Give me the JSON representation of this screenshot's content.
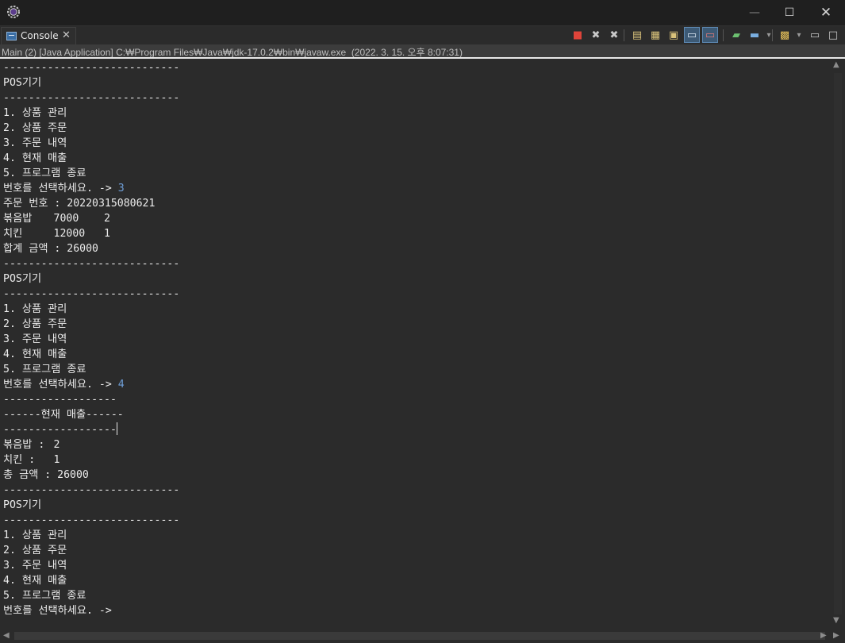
{
  "window": {
    "minimize_glyph": "—",
    "maximize_glyph": "☐",
    "close_glyph": "✕",
    "app_icon": "eclipse-gear-icon"
  },
  "tab": {
    "label": "Console",
    "close_glyph": "✕",
    "icon": "console-icon"
  },
  "toolbar": [
    {
      "name": "terminate-icon",
      "glyph": "■",
      "color": "#e0443a",
      "active": false
    },
    {
      "name": "remove-launch-icon",
      "glyph": "✖",
      "color": "#c9c9c9",
      "active": false
    },
    {
      "name": "remove-all-terminated-icon",
      "glyph": "✖",
      "color": "#c9c9c9",
      "active": false
    },
    {
      "name": "clear-console-icon",
      "glyph": "▤",
      "color": "#d9c27a",
      "active": false
    },
    {
      "name": "scroll-lock-icon",
      "glyph": "▦",
      "color": "#d9c27a",
      "active": false
    },
    {
      "name": "word-wrap-icon",
      "glyph": "▣",
      "color": "#d9c27a",
      "active": false
    },
    {
      "name": "show-on-stdout-icon",
      "glyph": "▭",
      "color": "#d9e6f2",
      "active": true
    },
    {
      "name": "show-on-stderr-icon",
      "glyph": "▭",
      "color": "#e07a7a",
      "active": true
    },
    {
      "name": "pin-console-icon",
      "glyph": "▰",
      "color": "#6cc070",
      "active": false
    },
    {
      "name": "display-selected-console-icon",
      "glyph": "▬",
      "color": "#7aaee0",
      "active": false
    },
    {
      "name": "display-dropdown-icon",
      "glyph": "▾",
      "color": "#9a9a9a",
      "active": false
    },
    {
      "name": "open-console-icon",
      "glyph": "▩",
      "color": "#e6c15a",
      "active": false
    },
    {
      "name": "open-dropdown-icon",
      "glyph": "▾",
      "color": "#9a9a9a",
      "active": false
    },
    {
      "name": "view-minimize-icon",
      "glyph": "▭",
      "color": "#c9c9c9",
      "active": false
    },
    {
      "name": "view-maximize-icon",
      "glyph": "□",
      "color": "#c9c9c9",
      "active": false
    }
  ],
  "launch_info": "Main (2) [Java Application] C:₩Program Files₩Java₩jdk-17.0.2₩bin₩javaw.exe  (2022. 3. 15. 오후 8:07:31)",
  "console": {
    "lines": [
      {
        "text": "----------------------------"
      },
      {
        "text": "POS기기"
      },
      {
        "text": "----------------------------"
      },
      {
        "text": "1. 상품 관리"
      },
      {
        "text": "2. 상품 주문"
      },
      {
        "text": "3. 주문 내역"
      },
      {
        "text": "4. 현재 매출"
      },
      {
        "text": "5. 프로그램 종료"
      },
      {
        "text": "번호를 선택하세요. -> ",
        "input": "3"
      },
      {
        "text": "주문 번호 : 20220315080621"
      },
      {
        "text": "볶음밥\t7000\t2"
      },
      {
        "text": "치킨\t12000\t1"
      },
      {
        "text": "합계 금액 : 26000"
      },
      {
        "text": "----------------------------"
      },
      {
        "text": "POS기기"
      },
      {
        "text": "----------------------------"
      },
      {
        "text": "1. 상품 관리"
      },
      {
        "text": "2. 상품 주문"
      },
      {
        "text": "3. 주문 내역"
      },
      {
        "text": "4. 현재 매출"
      },
      {
        "text": "5. 프로그램 종료"
      },
      {
        "text": "번호를 선택하세요. -> ",
        "input": "4"
      },
      {
        "text": "------------------"
      },
      {
        "text": "------현재 매출------"
      },
      {
        "text": "------------------",
        "cursor": true
      },
      {
        "text": "볶음밥 :\t2"
      },
      {
        "text": "치킨 :\t1"
      },
      {
        "text": "총 금액 : 26000"
      },
      {
        "text": "----------------------------"
      },
      {
        "text": "POS기기"
      },
      {
        "text": "----------------------------"
      },
      {
        "text": "1. 상품 관리"
      },
      {
        "text": "2. 상품 주문"
      },
      {
        "text": "3. 주문 내역"
      },
      {
        "text": "4. 현재 매출"
      },
      {
        "text": "5. 프로그램 종료"
      },
      {
        "text": "번호를 선택하세요. -> "
      }
    ]
  },
  "scroll": {
    "up": "▲",
    "down": "▼",
    "left": "◀",
    "right": "▶"
  }
}
